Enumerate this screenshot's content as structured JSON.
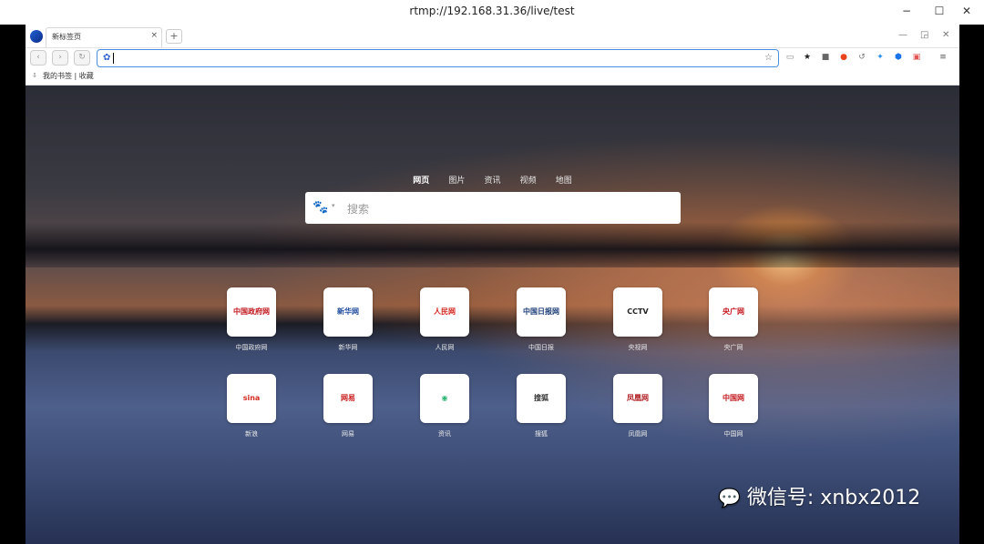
{
  "window": {
    "title": "rtmp://192.168.31.36/live/test",
    "minimize": "−",
    "maximize": "☐",
    "close": "✕"
  },
  "browser": {
    "tab": {
      "label": "新标签页",
      "close": "×"
    },
    "new_tab": "+",
    "controls": {
      "minimize": "—",
      "restore": "◲",
      "close": "✕"
    },
    "nav": {
      "back": "‹",
      "forward": "›",
      "reload": "↻"
    },
    "omnibox": {
      "icon": "✿",
      "value": "",
      "star": "☆"
    },
    "bookmarks_bar": {
      "label": "我的书签 | 收藏"
    }
  },
  "search": {
    "tabs": [
      "网页",
      "图片",
      "资讯",
      "视频",
      "地图"
    ],
    "active_tab": "网页",
    "engine_icon": "baidu-paw-icon",
    "placeholder": "搜索"
  },
  "shortcuts": [
    {
      "label": "中国政府网",
      "logo": "中国政府网",
      "color": "#c0151b"
    },
    {
      "label": "新华网",
      "logo": "新华网",
      "color": "#1b4a9c"
    },
    {
      "label": "人民网",
      "logo": "人民网",
      "color": "#d3241d"
    },
    {
      "label": "中国日报",
      "logo": "中国日报网",
      "color": "#1a3c78"
    },
    {
      "label": "央视网",
      "logo": "CCTV",
      "color": "#222222"
    },
    {
      "label": "央广网",
      "logo": "央广网",
      "color": "#c3161c"
    },
    {
      "label": "新浪",
      "logo": "sina",
      "color": "#d22b1f"
    },
    {
      "label": "网易",
      "logo": "网易",
      "color": "#c81a1a"
    },
    {
      "label": "资讯",
      "logo": "◉",
      "color": "#2bb673"
    },
    {
      "label": "搜狐",
      "logo": "搜狐",
      "color": "#333333"
    },
    {
      "label": "凤凰网",
      "logo": "凤凰网",
      "color": "#b11f24"
    },
    {
      "label": "中国网",
      "logo": "中国网",
      "color": "#c3161c"
    }
  ],
  "watermark": "微信号: xnbx2012"
}
